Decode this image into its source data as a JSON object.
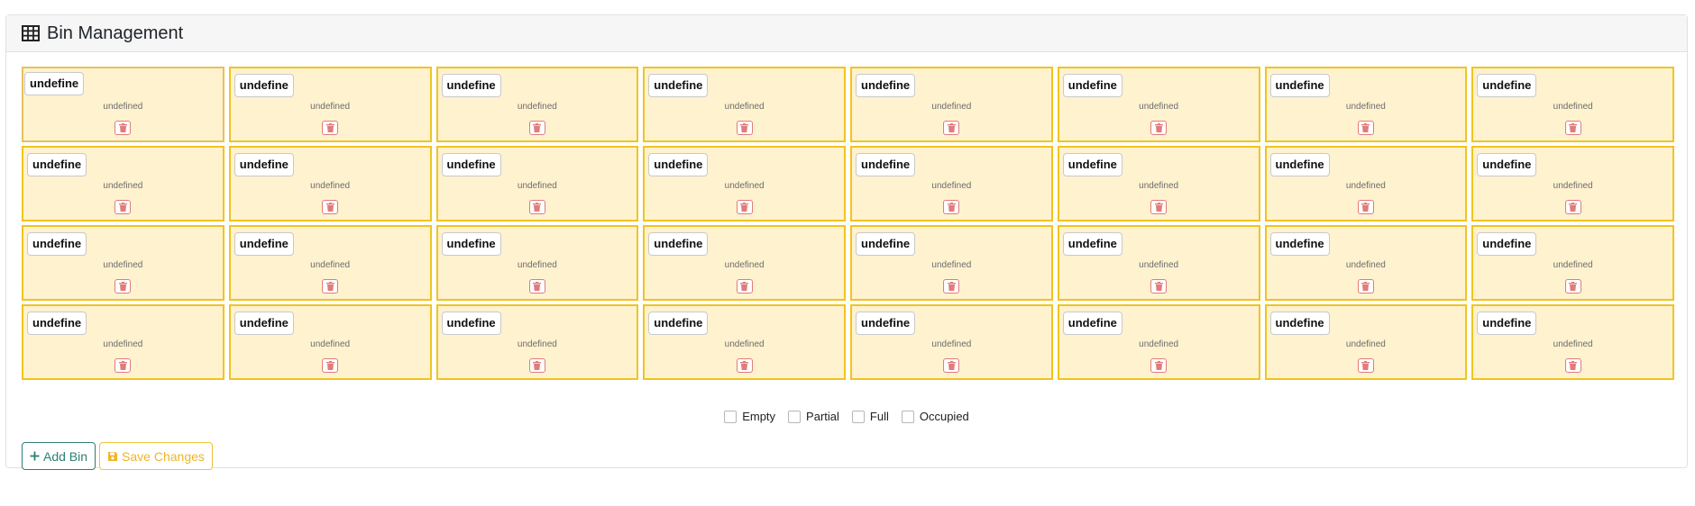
{
  "card": {
    "title": "Bin Management",
    "title_icon": "table-icon"
  },
  "bins": [
    {
      "code": "undefine",
      "status": "undefined"
    },
    {
      "code": "undefine",
      "status": "undefined"
    },
    {
      "code": "undefine",
      "status": "undefined"
    },
    {
      "code": "undefine",
      "status": "undefined"
    },
    {
      "code": "undefine",
      "status": "undefined"
    },
    {
      "code": "undefine",
      "status": "undefined"
    },
    {
      "code": "undefine",
      "status": "undefined"
    },
    {
      "code": "undefine",
      "status": "undefined"
    },
    {
      "code": "undefine",
      "status": "undefined"
    },
    {
      "code": "undefine",
      "status": "undefined"
    },
    {
      "code": "undefine",
      "status": "undefined"
    },
    {
      "code": "undefine",
      "status": "undefined"
    },
    {
      "code": "undefine",
      "status": "undefined"
    },
    {
      "code": "undefine",
      "status": "undefined"
    },
    {
      "code": "undefine",
      "status": "undefined"
    },
    {
      "code": "undefine",
      "status": "undefined"
    },
    {
      "code": "undefine",
      "status": "undefined"
    },
    {
      "code": "undefine",
      "status": "undefined"
    },
    {
      "code": "undefine",
      "status": "undefined"
    },
    {
      "code": "undefine",
      "status": "undefined"
    },
    {
      "code": "undefine",
      "status": "undefined"
    },
    {
      "code": "undefine",
      "status": "undefined"
    },
    {
      "code": "undefine",
      "status": "undefined"
    },
    {
      "code": "undefine",
      "status": "undefined"
    },
    {
      "code": "undefine",
      "status": "undefined"
    },
    {
      "code": "undefine",
      "status": "undefined"
    },
    {
      "code": "undefine",
      "status": "undefined"
    },
    {
      "code": "undefine",
      "status": "undefined"
    },
    {
      "code": "undefine",
      "status": "undefined"
    },
    {
      "code": "undefine",
      "status": "undefined"
    },
    {
      "code": "undefine",
      "status": "undefined"
    },
    {
      "code": "undefine",
      "status": "undefined"
    }
  ],
  "bin_style": {
    "border_color": "#f0c420",
    "fill_color": "#fff2cf",
    "delete_icon": "trash-icon",
    "delete_color": "#e27b7b"
  },
  "legend": [
    {
      "label": "Empty"
    },
    {
      "label": "Partial"
    },
    {
      "label": "Full"
    },
    {
      "label": "Occupied"
    }
  ],
  "actions": {
    "add_label": "Add Bin",
    "add_icon": "plus-icon",
    "add_color": "#2d7f74",
    "save_label": "Save Changes",
    "save_icon": "save-icon",
    "save_color": "#f0b429"
  }
}
